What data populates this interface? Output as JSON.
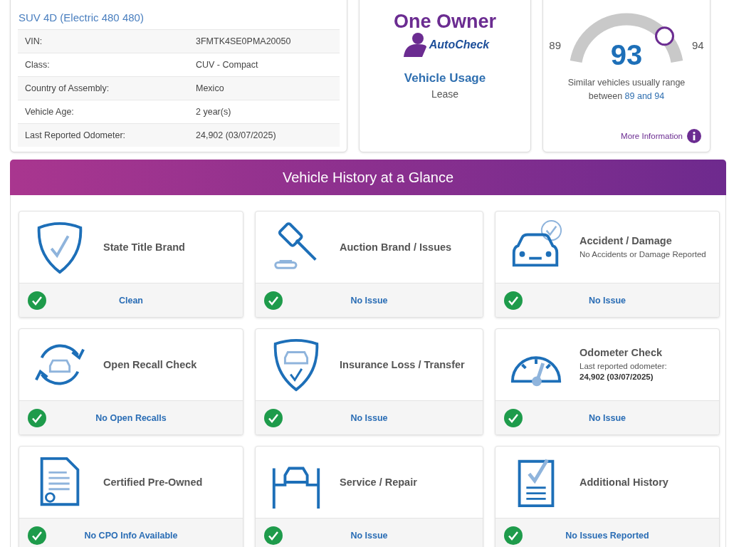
{
  "vehicle": {
    "subtitle": "SUV 4D (Electric 480 480)",
    "details": [
      {
        "label": "VIN:",
        "value": "3FMTK4SE0PMA20050"
      },
      {
        "label": "Class:",
        "value": "CUV - Compact"
      },
      {
        "label": "Country of Assembly:",
        "value": "Mexico"
      },
      {
        "label": "Vehicle Age:",
        "value": "2 year(s)"
      },
      {
        "label": "Last Reported Odometer:",
        "value": "24,902 (03/07/2025)"
      }
    ]
  },
  "owner": {
    "badge_title": "One Owner",
    "badge_brand": "AutoCheck",
    "usage_label": "Vehicle Usage",
    "usage_value": "Lease"
  },
  "score": {
    "min": "89",
    "max": "94",
    "value": "93",
    "level": 0.8,
    "note": "Similar vehicles usually range between **89 and 94**",
    "more_link": "More Information"
  },
  "glance": {
    "title": "Vehicle History at a Glance",
    "checks": [
      {
        "title": "State Title Brand",
        "result": "Clean",
        "passed": true
      },
      {
        "title": "Auction Brand / Issues",
        "result": "No Issue",
        "passed": true
      },
      {
        "title": "Accident / Damage",
        "detail": "No Accidents or Damage Reported",
        "result": "No Issue",
        "passed": true
      },
      {
        "title": "Open Recall Check",
        "result": "No Open Recalls",
        "passed": true
      },
      {
        "title": "Insurance Loss / Transfer",
        "result": "No Issue",
        "passed": true
      },
      {
        "title": "Odometer Check",
        "detail": "Last reported odometer: **24,902 (03/07/2025)**",
        "result": "No Issue",
        "passed": true
      },
      {
        "title": "Certified Pre-Owned",
        "result": "No CPO Info Available",
        "passed": true
      },
      {
        "title": "Service / Repair",
        "result": "No Issue",
        "passed": true
      },
      {
        "title": "Additional History",
        "result": "No Issues Reported",
        "passed": true
      }
    ]
  }
}
